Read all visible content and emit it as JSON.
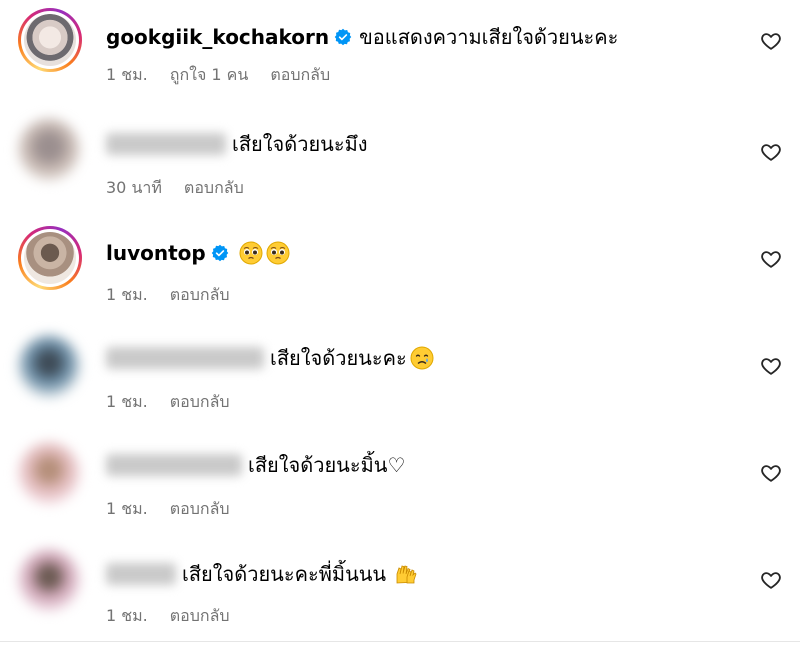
{
  "comments": [
    {
      "username": "gookgiik_kochakorn",
      "verified": true,
      "text": "ขอแสดงความเสียใจด้วยนะคะ",
      "time": "1 ชม.",
      "likes": "ถูกใจ 1 คน",
      "reply": "ตอบกลับ"
    },
    {
      "username": "",
      "verified": false,
      "text": "เสียใจด้วยนะมึง",
      "time": "30 นาที",
      "reply": "ตอบกลับ"
    },
    {
      "username": "luvontop",
      "verified": true,
      "text": "",
      "emojis": [
        "pleading-face-icon",
        "pleading-face-icon"
      ],
      "time": "1 ชม.",
      "reply": "ตอบกลับ"
    },
    {
      "username": "",
      "verified": false,
      "text": "เสียใจด้วยนะคะ",
      "emojis": [
        "crying-face-icon"
      ],
      "time": "1 ชม.",
      "reply": "ตอบกลับ"
    },
    {
      "username": "",
      "verified": false,
      "text": "เสียใจด้วยนะมิ้น♡",
      "time": "1 ชม.",
      "reply": "ตอบกลับ"
    },
    {
      "username": "",
      "verified": false,
      "text": "เสียใจด้วยนะคะพี่มิ้นนน",
      "emojis": [
        "raised-hands-icon"
      ],
      "time": "1 ชม.",
      "reply": "ตอบกลับ"
    }
  ],
  "colors": {
    "text": "#000000",
    "meta": "#737373",
    "verified": "#0095f6",
    "story_ring": "#d62976",
    "divider": "#e6e6e6"
  }
}
